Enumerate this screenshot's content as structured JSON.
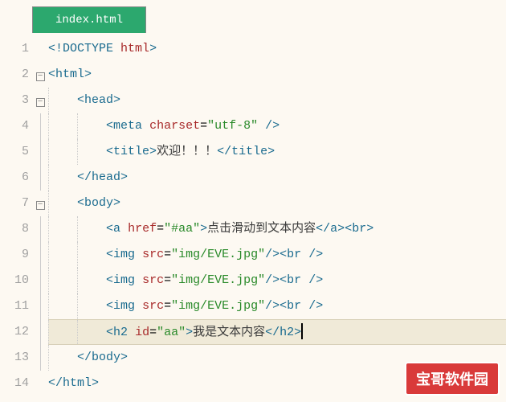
{
  "tab": {
    "filename": "index.html"
  },
  "lines": [
    {
      "num": "1",
      "fold": ""
    },
    {
      "num": "2",
      "fold": "box"
    },
    {
      "num": "3",
      "fold": "box"
    },
    {
      "num": "4",
      "fold": ""
    },
    {
      "num": "5",
      "fold": ""
    },
    {
      "num": "6",
      "fold": ""
    },
    {
      "num": "7",
      "fold": "box"
    },
    {
      "num": "8",
      "fold": ""
    },
    {
      "num": "9",
      "fold": ""
    },
    {
      "num": "10",
      "fold": ""
    },
    {
      "num": "11",
      "fold": ""
    },
    {
      "num": "12",
      "fold": ""
    },
    {
      "num": "13",
      "fold": ""
    },
    {
      "num": "14",
      "fold": ""
    }
  ],
  "code": {
    "l1": {
      "doctype_open": "<!",
      "doctype_kw": "DOCTYPE",
      "space": " ",
      "doctype_val": "html",
      "doctype_close": ">"
    },
    "l2": {
      "open": "<",
      "tag": "html",
      "close": ">"
    },
    "l3": {
      "open": "<",
      "tag": "head",
      "close": ">"
    },
    "l4": {
      "open": "<",
      "tag": "meta",
      "sp1": " ",
      "attr": "charset",
      "eq": "=",
      "val": "\"utf-8\"",
      "sp2": " ",
      "close": "/>"
    },
    "l5": {
      "open": "<",
      "tag": "title",
      "close": ">",
      "text": "欢迎！！！",
      "eopen": "</",
      "etag": "title",
      "eclose": ">"
    },
    "l6": {
      "open": "</",
      "tag": "head",
      "close": ">"
    },
    "l7": {
      "open": "<",
      "tag": "body",
      "close": ">"
    },
    "l8": {
      "open": "<",
      "tag": "a",
      "sp1": " ",
      "attr": "href",
      "eq": "=",
      "val": "\"#aa\"",
      "close": ">",
      "text": "点击滑动到文本内容",
      "eopen": "</",
      "etag": "a",
      "eclose": ">",
      "bopen": "<",
      "btag": "br",
      "bclose": ">"
    },
    "l9": {
      "open": "<",
      "tag": "img",
      "sp1": " ",
      "attr": "src",
      "eq": "=",
      "val": "\"img/EVE.jpg\"",
      "close": "/>",
      "bopen": "<",
      "btag": "br",
      "bsp": " ",
      "bclose": "/>"
    },
    "l10": {
      "open": "<",
      "tag": "img",
      "sp1": " ",
      "attr": "src",
      "eq": "=",
      "val": "\"img/EVE.jpg\"",
      "close": "/>",
      "bopen": "<",
      "btag": "br",
      "bsp": " ",
      "bclose": "/>"
    },
    "l11": {
      "open": "<",
      "tag": "img",
      "sp1": " ",
      "attr": "src",
      "eq": "=",
      "val": "\"img/EVE.jpg\"",
      "close": "/>",
      "bopen": "<",
      "btag": "br",
      "bsp": " ",
      "bclose": "/>"
    },
    "l12": {
      "open": "<",
      "tag": "h2",
      "sp1": " ",
      "attr": "id",
      "eq": "=",
      "val": "\"aa\"",
      "close": ">",
      "text": "我是文本内容",
      "eopen": "</",
      "etag": "h2",
      "eclose": ">"
    },
    "l13": {
      "open": "</",
      "tag": "body",
      "close": ">"
    },
    "l14": {
      "open": "</",
      "tag": "html",
      "close": ">"
    }
  },
  "watermark": "宝哥软件园"
}
